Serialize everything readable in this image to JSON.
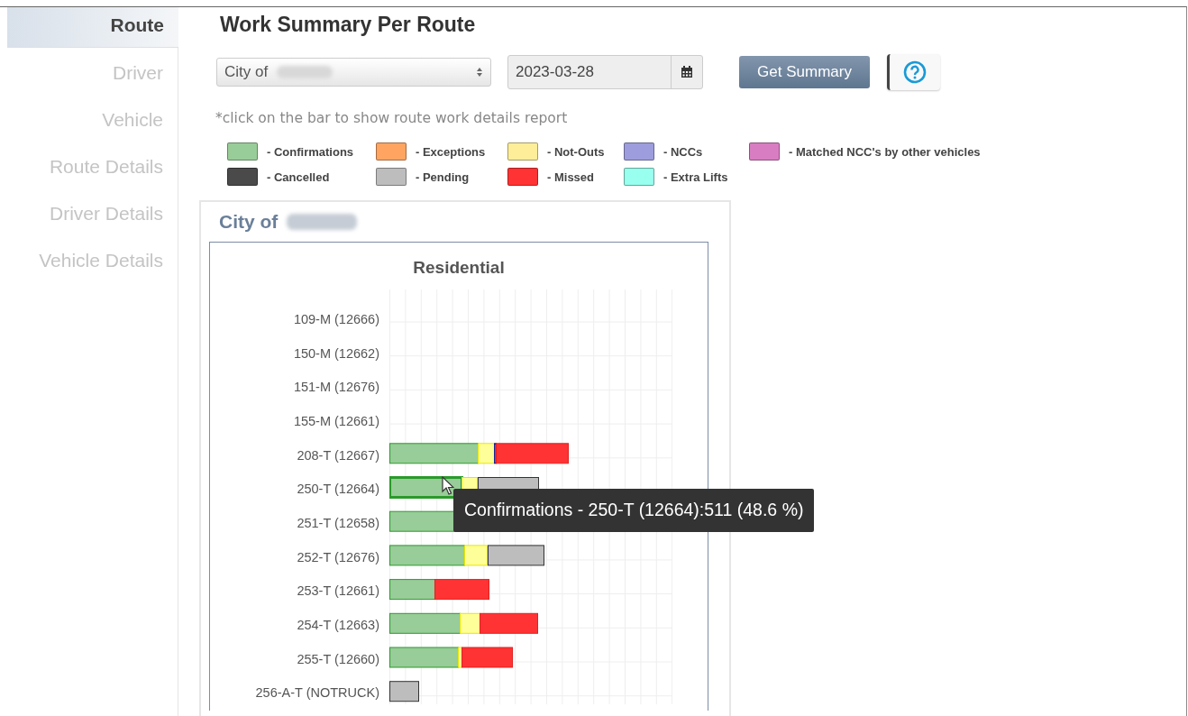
{
  "sidebar": {
    "items": [
      {
        "label": "Route",
        "selected": true
      },
      {
        "label": "Driver",
        "selected": false
      },
      {
        "label": "Vehicle",
        "selected": false
      },
      {
        "label": "Route Details",
        "selected": false
      },
      {
        "label": "Driver Details",
        "selected": false
      },
      {
        "label": "Vehicle Details",
        "selected": false
      }
    ]
  },
  "page_title": "Work Summary Per Route",
  "filters": {
    "city": {
      "value": "City of"
    },
    "date": {
      "value": "2023-03-28"
    },
    "submit": "Get Summary"
  },
  "hint": "*click on the bar to show route work details report",
  "legend": [
    {
      "label": "- Confirmations",
      "color": "#98cc98"
    },
    {
      "label": "- Exceptions",
      "color": "#ffa561"
    },
    {
      "label": "- Not-Outs",
      "color": "#ffee99"
    },
    {
      "label": "- NCCs",
      "color": "#9d9ddd"
    },
    {
      "label": "- Matched NCC's by other vehicles",
      "color": "#d97dc2"
    },
    {
      "label": "- Cancelled",
      "color": "#4a4a4a"
    },
    {
      "label": "- Pending",
      "color": "#bdbdbd"
    },
    {
      "label": "- Missed",
      "color": "#ff3333"
    },
    {
      "label": "- Extra Lifts",
      "color": "#99ffee"
    }
  ],
  "card": {
    "title": "City of",
    "chart": {
      "title": "Residential",
      "rows": [
        {
          "label": "109-M (12666)"
        },
        {
          "label": "150-M (12662)"
        },
        {
          "label": "151-M (12676)"
        },
        {
          "label": "155-M (12661)"
        },
        {
          "label": "208-T (12667)"
        },
        {
          "label": "250-T (12664)"
        },
        {
          "label": "251-T (12658)"
        },
        {
          "label": "252-T (12676)"
        },
        {
          "label": "253-T (12661)"
        },
        {
          "label": "254-T (12663)"
        },
        {
          "label": "255-T (12660)"
        },
        {
          "label": "256-A-T (NOTRUCK)"
        }
      ],
      "tooltip": "Confirmations - 250-T (12664):511 (48.6 %)"
    }
  }
}
